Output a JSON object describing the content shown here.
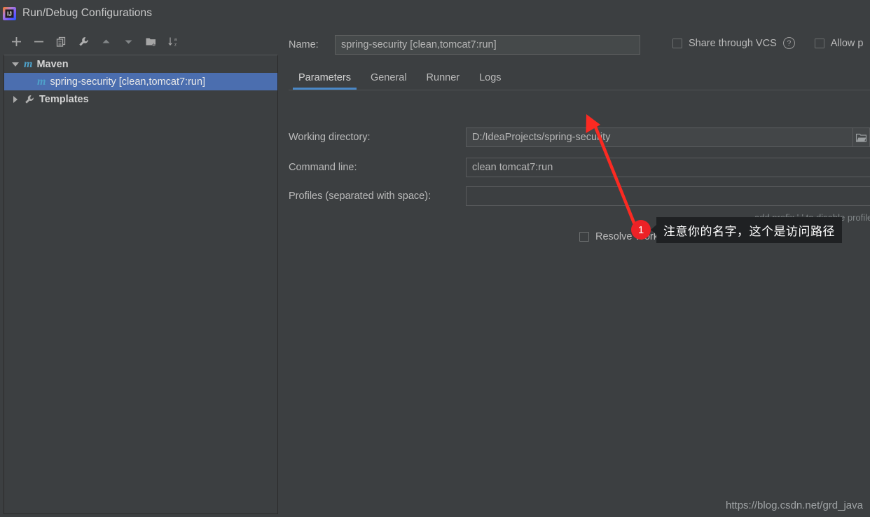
{
  "window": {
    "title": "Run/Debug Configurations",
    "app_icon": "intellij-idea-logo"
  },
  "toolbar": {
    "buttons": [
      {
        "name": "add-configuration-button",
        "icon": "plus-icon",
        "label": "+"
      },
      {
        "name": "remove-configuration-button",
        "icon": "minus-icon",
        "label": "−"
      },
      {
        "name": "copy-configuration-button",
        "icon": "copy-icon",
        "label": "Copy"
      },
      {
        "name": "edit-templates-button",
        "icon": "wrench-icon",
        "label": "Edit defaults"
      },
      {
        "name": "move-up-button",
        "icon": "arrow-up-icon",
        "label": "Move Up"
      },
      {
        "name": "move-down-button",
        "icon": "arrow-down-icon",
        "label": "Move Down"
      },
      {
        "name": "new-folder-button",
        "icon": "folder-plus-icon",
        "label": "Create New Folder"
      },
      {
        "name": "sort-configurations-button",
        "icon": "sort-az-icon",
        "label": "Sort Configurations"
      }
    ]
  },
  "tree": {
    "groups": [
      {
        "label": "Maven",
        "icon": "maven-icon",
        "expanded": true,
        "children": [
          {
            "label": "spring-security [clean,tomcat7:run]",
            "icon": "maven-icon",
            "selected": true
          }
        ]
      },
      {
        "label": "Templates",
        "icon": "wrench-icon",
        "expanded": false,
        "children": []
      }
    ]
  },
  "header": {
    "name_label": "Name:",
    "name_value": "spring-security [clean,tomcat7:run]",
    "name_placeholder": "",
    "share_label": "Share through VCS",
    "share_checked": false,
    "help_icon": "question-mark-icon",
    "allow_label": "Allow p",
    "allow_checked": false
  },
  "tabs": [
    {
      "label": "Parameters",
      "active": true
    },
    {
      "label": "General",
      "active": false
    },
    {
      "label": "Runner",
      "active": false
    },
    {
      "label": "Logs",
      "active": false
    }
  ],
  "form": {
    "working_directory": {
      "label": "Working directory:",
      "value": "D:/IdeaProjects/spring-security",
      "browse_icon": "folder-open-icon"
    },
    "command_line": {
      "label": "Command line:",
      "value": "clean tomcat7:run"
    },
    "profiles": {
      "label": "Profiles (separated with space):",
      "value": "",
      "hint": "add prefix '-' to disable profile, e.g. \"-test\""
    },
    "resolve_workspace": {
      "label": "Resolve Workspace artifacts",
      "checked": false
    }
  },
  "annotation": {
    "badge_number": "1",
    "text": "注意你的名字，这个是访问路径",
    "arrow_color": "#fb2a22"
  },
  "watermark": {
    "text": "https://blog.csdn.net/grd_java"
  },
  "colors": {
    "background": "#3c3f41",
    "selection": "#4b6eaf",
    "accent": "#4a88c7",
    "maven_blue": "#4ea1c9",
    "annotation_red": "#ec2227"
  }
}
